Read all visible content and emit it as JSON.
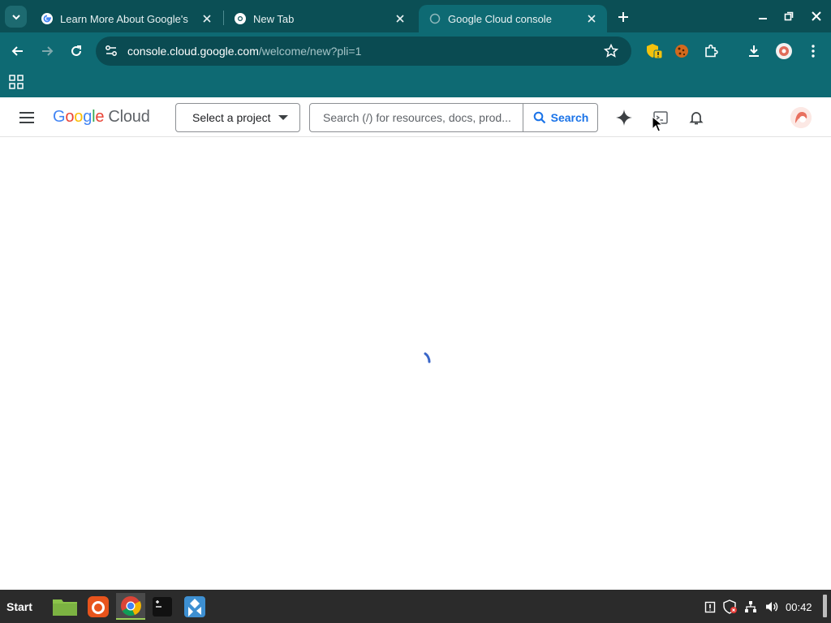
{
  "browser": {
    "tabs": [
      {
        "title": "Learn More About Google's",
        "favicon": "google-g-icon",
        "active": false
      },
      {
        "title": "New Tab",
        "favicon": "chrome-icon",
        "active": false
      },
      {
        "title": "Google Cloud console",
        "favicon": "loading-icon",
        "active": true
      }
    ],
    "url_host": "console.cloud.google.com",
    "url_path": "/welcome/new?pli=1",
    "colors": {
      "frame": "#0b4f55",
      "toolbar": "#0e6a73",
      "omnibox": "#0a4b52"
    }
  },
  "console": {
    "logo_google": "Google",
    "logo_cloud": "Cloud",
    "project_label": "Select a project",
    "search_placeholder": "Search (/) for resources, docs, prod...",
    "search_button": "Search",
    "icons": [
      "gemini-icon",
      "cloud-shell-icon",
      "notifications-icon",
      "avatar"
    ],
    "loading": true
  },
  "taskbar": {
    "start_label": "Start",
    "apps": [
      "file-manager-icon",
      "firefox-icon",
      "chrome-icon",
      "terminal-icon",
      "app-icon"
    ],
    "clock": "00:42"
  }
}
